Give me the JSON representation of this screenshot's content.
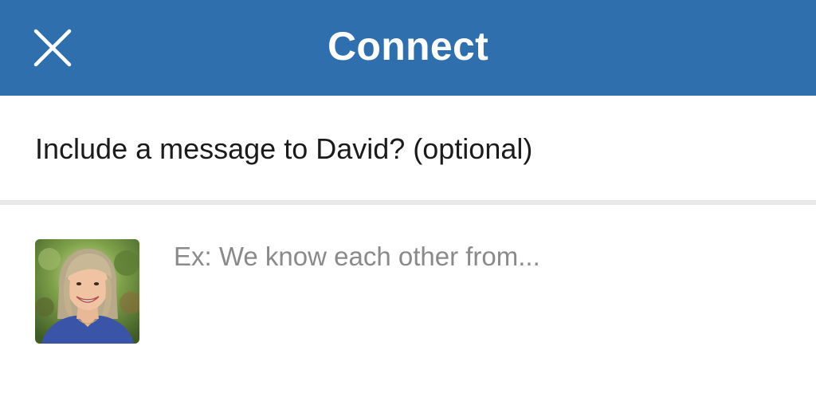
{
  "header": {
    "title": "Connect",
    "close_icon": "close-icon",
    "background": "#2f6fad"
  },
  "prompt": {
    "text": "Include a message to David? (optional)"
  },
  "message": {
    "placeholder": "Ex: We know each other from...",
    "value": ""
  },
  "recipient": {
    "avatar_icon": "avatar-photo"
  }
}
